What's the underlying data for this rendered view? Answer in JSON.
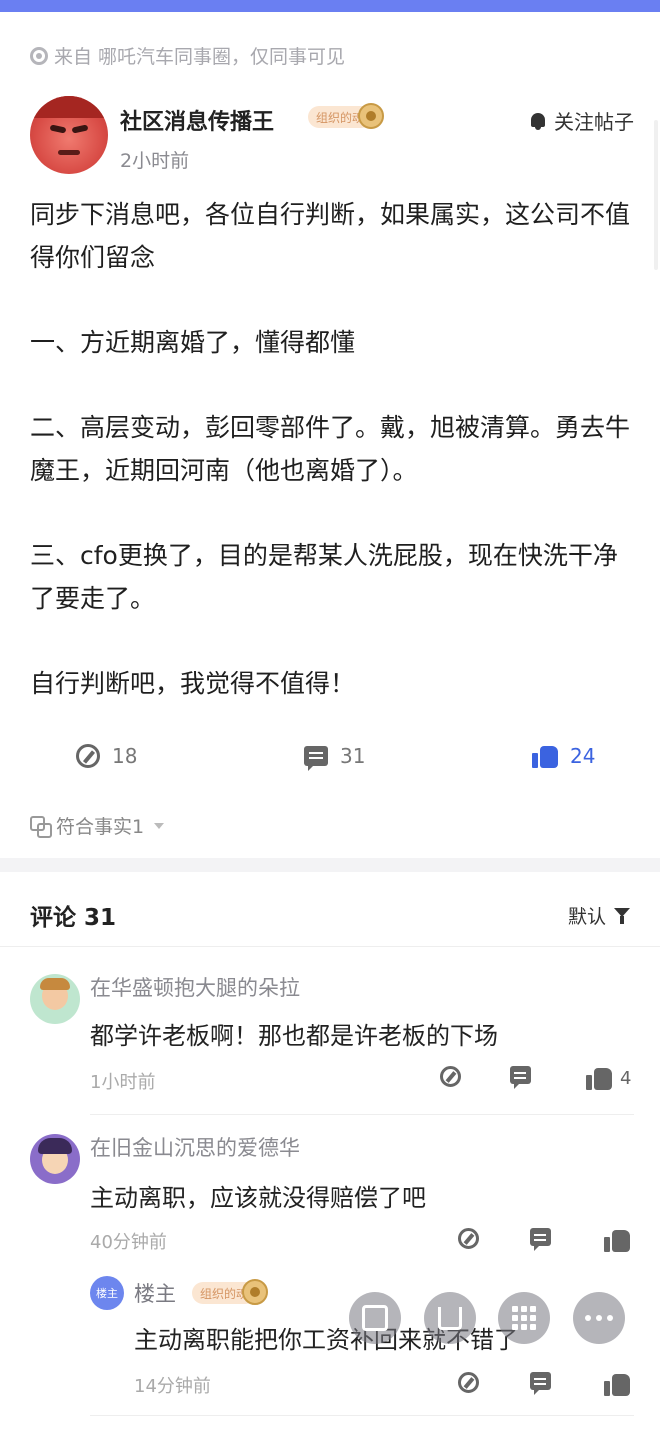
{
  "source": {
    "text": "来自 哪吒汽车同事圈，仅同事可见"
  },
  "post": {
    "author": "社区消息传播王",
    "badge": "组织的魂",
    "time": "2小时前",
    "follow_label": "关注帖子",
    "paragraphs": [
      "同步下消息吧，各位自行判断，如果属实，这公司不值得你们留念",
      "一、方近期离婚了，懂得都懂",
      "二、高层变动，彭回零部件了。戴，旭被清算。勇去牛魔王，近期回河南（他也离婚了）。",
      "三、cfo更换了，目的是帮某人洗屁股，现在快洗干净了要走了。",
      "自行判断吧，我觉得不值得！"
    ],
    "stats": {
      "reposts": "18",
      "comments": "31",
      "likes": "24"
    },
    "fact_label": "符合事实1"
  },
  "comments_section": {
    "title": "评论 31",
    "sort_label": "默认",
    "items": [
      {
        "name": "在华盛顿抱大腿的朵拉",
        "text": "都学许老板啊！那也都是许老板的下场",
        "time": "1小时前",
        "likes": "4"
      },
      {
        "name": "在旧金山沉思的爱德华",
        "text": "主动离职，应该就没得赔偿了吧",
        "time": "40分钟前",
        "likes": ""
      },
      {
        "name": "楼主",
        "badge": "组织的魂",
        "chip": "楼主",
        "text": "主动离职能把你工资补回来就不错了",
        "time": "14分钟前",
        "likes": ""
      }
    ]
  },
  "colors": {
    "accent": "#3b63e0",
    "topbar": "#6a7ff2",
    "badge_bg": "#fbe6d2"
  }
}
